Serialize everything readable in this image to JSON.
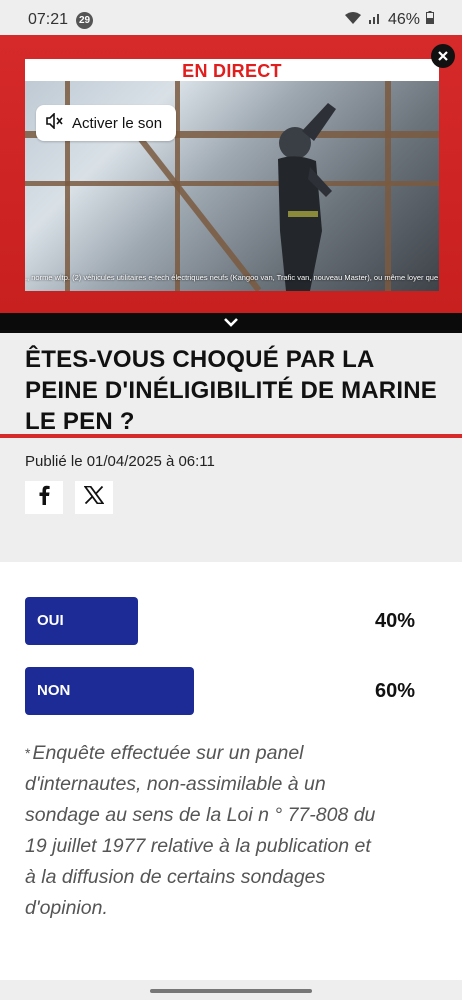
{
  "status_bar": {
    "time": "07:21",
    "notification_count": "29",
    "battery": "46%",
    "icons": [
      "wifi-icon",
      "signal-icon",
      "battery-icon"
    ]
  },
  "player": {
    "live_label": "EN DIRECT",
    "unmute_label": "Activer le son",
    "caption": "., norme wltp. (2) véhicules utilitaires e-tech électriques neufs (Kangoo van, Trafic van, nouveau Master), ou même loyer que leur équivalent",
    "close_icon": "close-icon",
    "collapse_icon": "chevron-down-icon"
  },
  "article": {
    "title": "ÊTES-VOUS CHOQUÉ PAR LA PEINE D'INÉLIGIBILITÉ DE MARINE LE PEN ?",
    "published": "Publié le 01/04/2025 à 06:11",
    "share": [
      "facebook-icon",
      "x-icon"
    ]
  },
  "poll": {
    "options": [
      {
        "label": "OUI",
        "percent_text": "40%",
        "value": 0.4
      },
      {
        "label": "NON",
        "percent_text": "60%",
        "value": 0.6
      }
    ],
    "footnote_mark": "*",
    "footnote": "Enquête effectuée sur un panel d'internautes, non-assimilable à un sondage au sens de la Loi n ° 77-808 du 19 juillet 1977 relative à la publication et à la diffusion de certains sondages d'opinion."
  },
  "colors": {
    "brand_red": "#d62a2a",
    "poll_blue": "#1c2b96",
    "header_bg": "#eeeeee"
  }
}
